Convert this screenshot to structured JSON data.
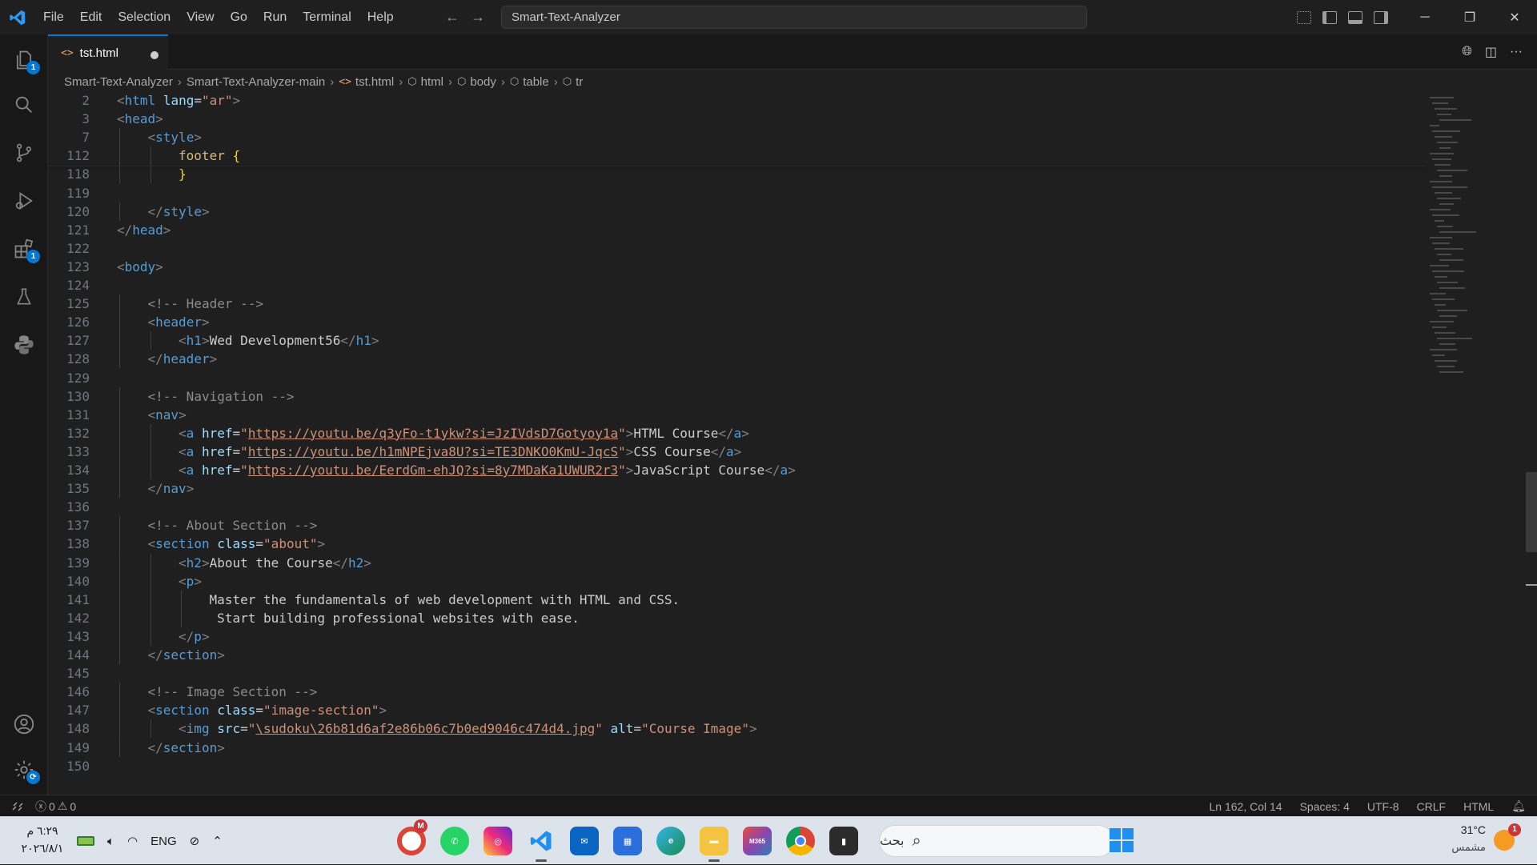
{
  "menu": [
    "File",
    "Edit",
    "Selection",
    "View",
    "Go",
    "Run",
    "Terminal",
    "Help"
  ],
  "command_center": "Smart-Text-Analyzer",
  "activity_badges": {
    "explorer": "1",
    "extensions": "1"
  },
  "tab": {
    "label": "tst.html",
    "icon": "<>"
  },
  "breadcrumb": {
    "folder1": "Smart-Text-Analyzer",
    "folder2": "Smart-Text-Analyzer-main",
    "file": "tst.html",
    "s1": "html",
    "s2": "body",
    "s3": "table",
    "s4": "tr"
  },
  "code": [
    {
      "n": "2",
      "i": 0,
      "t": [
        [
          "br",
          "<"
        ],
        [
          "tag",
          "html"
        ],
        [
          "",
          " "
        ],
        [
          "attr",
          "lang"
        ],
        [
          "",
          "="
        ],
        [
          "str",
          "\"ar\""
        ],
        [
          "br",
          ">"
        ]
      ]
    },
    {
      "n": "3",
      "i": 0,
      "t": [
        [
          "br",
          "<"
        ],
        [
          "tag",
          "head"
        ],
        [
          "br",
          ">"
        ]
      ]
    },
    {
      "n": "7",
      "i": 1,
      "t": [
        [
          "br",
          "<"
        ],
        [
          "tag",
          "style"
        ],
        [
          "br",
          ">"
        ]
      ]
    },
    {
      "n": "112",
      "i": 2,
      "t": [
        [
          "sel",
          "footer"
        ],
        [
          "",
          " "
        ],
        [
          "brace",
          "{"
        ]
      ]
    },
    {
      "n": "118",
      "i": 2,
      "t": [
        [
          "brace",
          "}"
        ]
      ]
    },
    {
      "n": "119",
      "i": 0,
      "t": []
    },
    {
      "n": "120",
      "i": 1,
      "t": [
        [
          "br",
          "</"
        ],
        [
          "tag",
          "style"
        ],
        [
          "br",
          ">"
        ]
      ]
    },
    {
      "n": "121",
      "i": 0,
      "t": [
        [
          "br",
          "</"
        ],
        [
          "tag",
          "head"
        ],
        [
          "br",
          ">"
        ]
      ]
    },
    {
      "n": "122",
      "i": 0,
      "t": []
    },
    {
      "n": "123",
      "i": 0,
      "t": [
        [
          "br",
          "<"
        ],
        [
          "tag",
          "body"
        ],
        [
          "br",
          ">"
        ]
      ]
    },
    {
      "n": "124",
      "i": 0,
      "t": []
    },
    {
      "n": "125",
      "i": 1,
      "t": [
        [
          "cmt",
          "<!-- Header -->"
        ]
      ]
    },
    {
      "n": "126",
      "i": 1,
      "t": [
        [
          "br",
          "<"
        ],
        [
          "tag",
          "header"
        ],
        [
          "br",
          ">"
        ]
      ]
    },
    {
      "n": "127",
      "i": 2,
      "t": [
        [
          "br",
          "<"
        ],
        [
          "tag",
          "h1"
        ],
        [
          "br",
          ">"
        ],
        [
          "",
          "Wed Development56"
        ],
        [
          "br",
          "</"
        ],
        [
          "tag",
          "h1"
        ],
        [
          "br",
          ">"
        ]
      ]
    },
    {
      "n": "128",
      "i": 1,
      "t": [
        [
          "br",
          "</"
        ],
        [
          "tag",
          "header"
        ],
        [
          "br",
          ">"
        ]
      ]
    },
    {
      "n": "129",
      "i": 0,
      "t": []
    },
    {
      "n": "130",
      "i": 1,
      "t": [
        [
          "cmt",
          "<!-- Navigation -->"
        ]
      ]
    },
    {
      "n": "131",
      "i": 1,
      "t": [
        [
          "br",
          "<"
        ],
        [
          "tag",
          "nav"
        ],
        [
          "br",
          ">"
        ]
      ]
    },
    {
      "n": "132",
      "i": 2,
      "t": [
        [
          "br",
          "<"
        ],
        [
          "tag",
          "a"
        ],
        [
          "",
          " "
        ],
        [
          "attr",
          "href"
        ],
        [
          "",
          "="
        ],
        [
          "str",
          "\""
        ],
        [
          "url",
          "https://youtu.be/q3yFo-t1ykw?si=JzIVdsD7Gotyoy1a"
        ],
        [
          "str",
          "\""
        ],
        [
          "br",
          ">"
        ],
        [
          "",
          "HTML Course"
        ],
        [
          "br",
          "</"
        ],
        [
          "tag",
          "a"
        ],
        [
          "br",
          ">"
        ]
      ]
    },
    {
      "n": "133",
      "i": 2,
      "t": [
        [
          "br",
          "<"
        ],
        [
          "tag",
          "a"
        ],
        [
          "",
          " "
        ],
        [
          "attr",
          "href"
        ],
        [
          "",
          "="
        ],
        [
          "str",
          "\""
        ],
        [
          "url",
          "https://youtu.be/h1mNPEjva8U?si=TE3DNKO0KmU-JqcS"
        ],
        [
          "str",
          "\""
        ],
        [
          "br",
          ">"
        ],
        [
          "",
          "CSS Course"
        ],
        [
          "br",
          "</"
        ],
        [
          "tag",
          "a"
        ],
        [
          "br",
          ">"
        ]
      ]
    },
    {
      "n": "134",
      "i": 2,
      "t": [
        [
          "br",
          "<"
        ],
        [
          "tag",
          "a"
        ],
        [
          "",
          " "
        ],
        [
          "attr",
          "href"
        ],
        [
          "",
          "="
        ],
        [
          "str",
          "\""
        ],
        [
          "url",
          "https://youtu.be/EerdGm-ehJQ?si=8y7MDaKa1UWUR2r3"
        ],
        [
          "str",
          "\""
        ],
        [
          "br",
          ">"
        ],
        [
          "",
          "JavaScript Course"
        ],
        [
          "br",
          "</"
        ],
        [
          "tag",
          "a"
        ],
        [
          "br",
          ">"
        ]
      ]
    },
    {
      "n": "135",
      "i": 1,
      "t": [
        [
          "br",
          "</"
        ],
        [
          "tag",
          "nav"
        ],
        [
          "br",
          ">"
        ]
      ]
    },
    {
      "n": "136",
      "i": 0,
      "t": []
    },
    {
      "n": "137",
      "i": 1,
      "t": [
        [
          "cmt",
          "<!-- About Section -->"
        ]
      ]
    },
    {
      "n": "138",
      "i": 1,
      "t": [
        [
          "br",
          "<"
        ],
        [
          "tag",
          "section"
        ],
        [
          "",
          " "
        ],
        [
          "attr",
          "class"
        ],
        [
          "",
          "="
        ],
        [
          "str",
          "\"about\""
        ],
        [
          "br",
          ">"
        ]
      ]
    },
    {
      "n": "139",
      "i": 2,
      "t": [
        [
          "br",
          "<"
        ],
        [
          "tag",
          "h2"
        ],
        [
          "br",
          ">"
        ],
        [
          "",
          "About the Course"
        ],
        [
          "br",
          "</"
        ],
        [
          "tag",
          "h2"
        ],
        [
          "br",
          ">"
        ]
      ]
    },
    {
      "n": "140",
      "i": 2,
      "t": [
        [
          "br",
          "<"
        ],
        [
          "tag",
          "p"
        ],
        [
          "br",
          ">"
        ]
      ]
    },
    {
      "n": "141",
      "i": 3,
      "t": [
        [
          "",
          "Master the fundamentals of web development with HTML and CSS."
        ]
      ]
    },
    {
      "n": "142",
      "i": 3,
      "t": [
        [
          "",
          " Start building professional websites with ease."
        ]
      ]
    },
    {
      "n": "143",
      "i": 2,
      "t": [
        [
          "br",
          "</"
        ],
        [
          "tag",
          "p"
        ],
        [
          "br",
          ">"
        ]
      ]
    },
    {
      "n": "144",
      "i": 1,
      "t": [
        [
          "br",
          "</"
        ],
        [
          "tag",
          "section"
        ],
        [
          "br",
          ">"
        ]
      ]
    },
    {
      "n": "145",
      "i": 0,
      "t": []
    },
    {
      "n": "146",
      "i": 1,
      "t": [
        [
          "cmt",
          "<!-- Image Section -->"
        ]
      ]
    },
    {
      "n": "147",
      "i": 1,
      "t": [
        [
          "br",
          "<"
        ],
        [
          "tag",
          "section"
        ],
        [
          "",
          " "
        ],
        [
          "attr",
          "class"
        ],
        [
          "",
          "="
        ],
        [
          "str",
          "\"image-section\""
        ],
        [
          "br",
          ">"
        ]
      ]
    },
    {
      "n": "148",
      "i": 2,
      "t": [
        [
          "br",
          "<"
        ],
        [
          "tag",
          "img"
        ],
        [
          "",
          " "
        ],
        [
          "attr",
          "src"
        ],
        [
          "",
          "="
        ],
        [
          "str",
          "\""
        ],
        [
          "url",
          "\\sudoku\\26b81d6af2e86b06c7b0ed9046c474d4.jpg"
        ],
        [
          "str",
          "\""
        ],
        [
          "",
          " "
        ],
        [
          "attr",
          "alt"
        ],
        [
          "",
          "="
        ],
        [
          "str",
          "\"Course Image\""
        ],
        [
          "br",
          ">"
        ]
      ]
    },
    {
      "n": "149",
      "i": 1,
      "t": [
        [
          "br",
          "</"
        ],
        [
          "tag",
          "section"
        ],
        [
          "br",
          ">"
        ]
      ]
    },
    {
      "n": "150",
      "i": 0,
      "t": []
    }
  ],
  "status": {
    "errors": "0",
    "warnings": "0",
    "position": "Ln 162, Col 14",
    "spaces": "Spaces: 4",
    "encoding": "UTF-8",
    "eol": "CRLF",
    "language": "HTML"
  },
  "taskbar": {
    "time": "٦:٢٩ م",
    "date": "٢٠٢٦/٨/١",
    "lang": "ENG",
    "search_placeholder": "بحث",
    "temp": "31°C",
    "weather": "مشمس",
    "weather_badge": "1",
    "chrome_badge": "M",
    "m365": "M365"
  }
}
